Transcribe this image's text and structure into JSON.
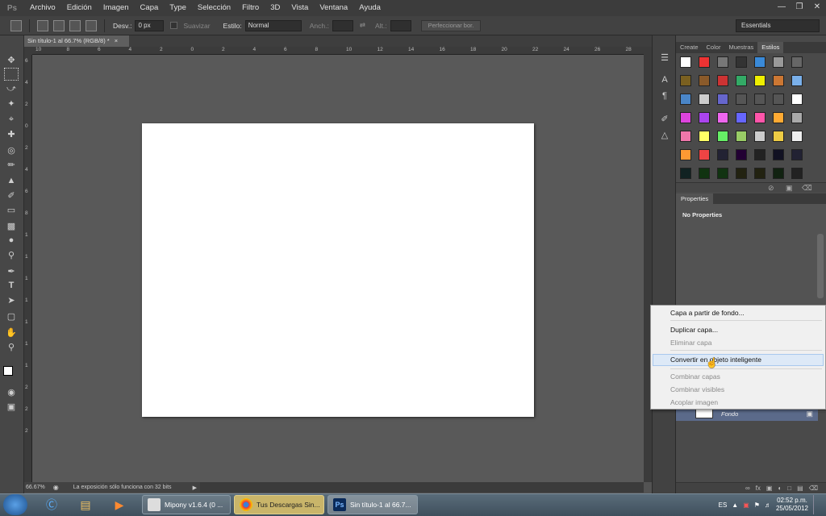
{
  "app": {
    "logo": "Ps"
  },
  "menu": [
    "Archivo",
    "Edición",
    "Imagen",
    "Capa",
    "Type",
    "Selección",
    "Filtro",
    "3D",
    "Vista",
    "Ventana",
    "Ayuda"
  ],
  "options": {
    "feather_label": "Desv.:",
    "feather_value": "0 px",
    "smooth_label": "Suavizar",
    "style_label": "Estilo:",
    "style_value": "Normal",
    "width_label": "Anch.:",
    "height_label": "Alt.:",
    "refine_label": "Perfeccionar bor."
  },
  "workspace": "Essentials",
  "document": {
    "tab_title": "Sin título-1 al 66.7% (RGB/8) *",
    "zoom": "66.67%",
    "status": "La exposición sólo funciona con 32 bits"
  },
  "ruler_top": [
    "10",
    "8",
    "6",
    "4",
    "2",
    "0",
    "2",
    "4",
    "6",
    "8",
    "10",
    "12",
    "14",
    "16",
    "18",
    "20",
    "22",
    "24",
    "26",
    "28"
  ],
  "ruler_left": [
    "6",
    "4",
    "2",
    "0",
    "2",
    "4",
    "6",
    "8",
    "1",
    "1",
    "1",
    "1",
    "1",
    "1",
    "1",
    "2",
    "2",
    "2"
  ],
  "styles_panel": {
    "tabs": [
      "Create",
      "Color",
      "Muestras",
      "Estilos"
    ],
    "active_tab": "Estilos"
  },
  "properties_panel": {
    "tab": "Properties",
    "empty_text": "No Properties"
  },
  "layers": {
    "row_name": "Fondo"
  },
  "context_menu": {
    "items": [
      {
        "label": "Capa a partir de fondo...",
        "enabled": true
      },
      {
        "label": "Duplicar capa...",
        "enabled": true
      },
      {
        "label": "Eliminar capa",
        "enabled": false
      },
      {
        "label": "Convertir en objeto inteligente",
        "enabled": true,
        "highlighted": true
      },
      {
        "label": "Combinar capas",
        "enabled": false
      },
      {
        "label": "Combinar visibles",
        "enabled": false
      },
      {
        "label": "Acoplar imagen",
        "enabled": false
      }
    ]
  },
  "taskbar": {
    "tasks": [
      {
        "label": "Mipony v1.6.4 (0 ..."
      },
      {
        "label": "Tus Descargas Sin..."
      },
      {
        "label": "Sin título-1 al 66.7..."
      }
    ],
    "lang": "ES",
    "time": "02:52 p.m.",
    "date": "25/05/2012"
  }
}
